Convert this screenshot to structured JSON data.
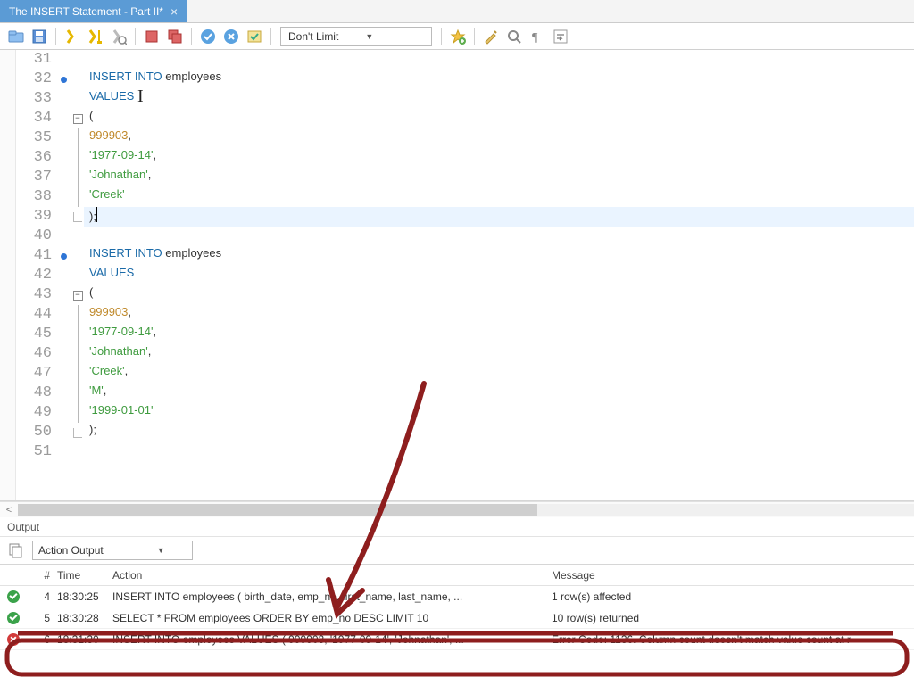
{
  "tab": {
    "title": "The INSERT Statement - Part II*",
    "close": "×"
  },
  "toolbar": {
    "limit_label": "Don't Limit"
  },
  "editor": {
    "lines": [
      {
        "n": 31,
        "mark": "",
        "fold": "",
        "html": ""
      },
      {
        "n": 32,
        "mark": "dot",
        "fold": "",
        "html": "<span class='kw'>INSERT</span> <span class='kw'>INTO</span> employees"
      },
      {
        "n": 33,
        "mark": "",
        "fold": "",
        "html": "<span class='kw'>VALUES</span>   <span class='ibeam'>I</span>"
      },
      {
        "n": 34,
        "mark": "",
        "fold": "box",
        "html": "("
      },
      {
        "n": 35,
        "mark": "",
        "fold": "line",
        "html": "    <span class='num'>999903</span>,"
      },
      {
        "n": 36,
        "mark": "",
        "fold": "line",
        "html": "    <span class='str'>'1977-09-14'</span>,"
      },
      {
        "n": 37,
        "mark": "",
        "fold": "line",
        "html": "    <span class='str'>'Johnathan'</span>,"
      },
      {
        "n": 38,
        "mark": "",
        "fold": "line",
        "html": "    <span class='str'>'Creek'</span>"
      },
      {
        "n": 39,
        "mark": "",
        "fold": "end",
        "html": ");<span class='cursor'></span>",
        "hl": true
      },
      {
        "n": 40,
        "mark": "",
        "fold": "",
        "html": ""
      },
      {
        "n": 41,
        "mark": "dot",
        "fold": "",
        "html": "<span class='kw'>INSERT</span> <span class='kw'>INTO</span> employees"
      },
      {
        "n": 42,
        "mark": "",
        "fold": "",
        "html": "<span class='kw'>VALUES</span>"
      },
      {
        "n": 43,
        "mark": "",
        "fold": "box",
        "html": "("
      },
      {
        "n": 44,
        "mark": "",
        "fold": "line",
        "html": "    <span class='num'>999903</span>,"
      },
      {
        "n": 45,
        "mark": "",
        "fold": "line",
        "html": "    <span class='str'>'1977-09-14'</span>,"
      },
      {
        "n": 46,
        "mark": "",
        "fold": "line",
        "html": "    <span class='str'>'Johnathan'</span>,"
      },
      {
        "n": 47,
        "mark": "",
        "fold": "line",
        "html": "    <span class='str'>'Creek'</span>,"
      },
      {
        "n": 48,
        "mark": "",
        "fold": "line",
        "html": "    <span class='str'>'M'</span>,"
      },
      {
        "n": 49,
        "mark": "",
        "fold": "line",
        "html": "    <span class='str'>'1999-01-01'</span>"
      },
      {
        "n": 50,
        "mark": "",
        "fold": "end",
        "html": ");"
      },
      {
        "n": 51,
        "mark": "",
        "fold": "",
        "html": ""
      }
    ]
  },
  "output": {
    "panel_label": "Output",
    "combo": "Action Output",
    "headers": {
      "idx": "#",
      "time": "Time",
      "action": "Action",
      "message": "Message"
    },
    "rows": [
      {
        "status": "ok",
        "idx": "4",
        "time": "18:30:25",
        "action": "INSERT INTO employees ( birth_date,    emp_no,    first_name,    last_name,   ...",
        "message": "1 row(s) affected"
      },
      {
        "status": "ok",
        "idx": "5",
        "time": "18:30:28",
        "action": "SELECT     * FROM     employees ORDER BY emp_no DESC LIMIT 10",
        "message": "10 row(s) returned"
      },
      {
        "status": "err",
        "idx": "6",
        "time": "18:31:30",
        "action": "INSERT INTO employees VALUES (  999903,     '1977-09-14',     'Johnathan',    ...",
        "message": "Error Code: 1136. Column count doesn't match value count at r"
      }
    ]
  }
}
